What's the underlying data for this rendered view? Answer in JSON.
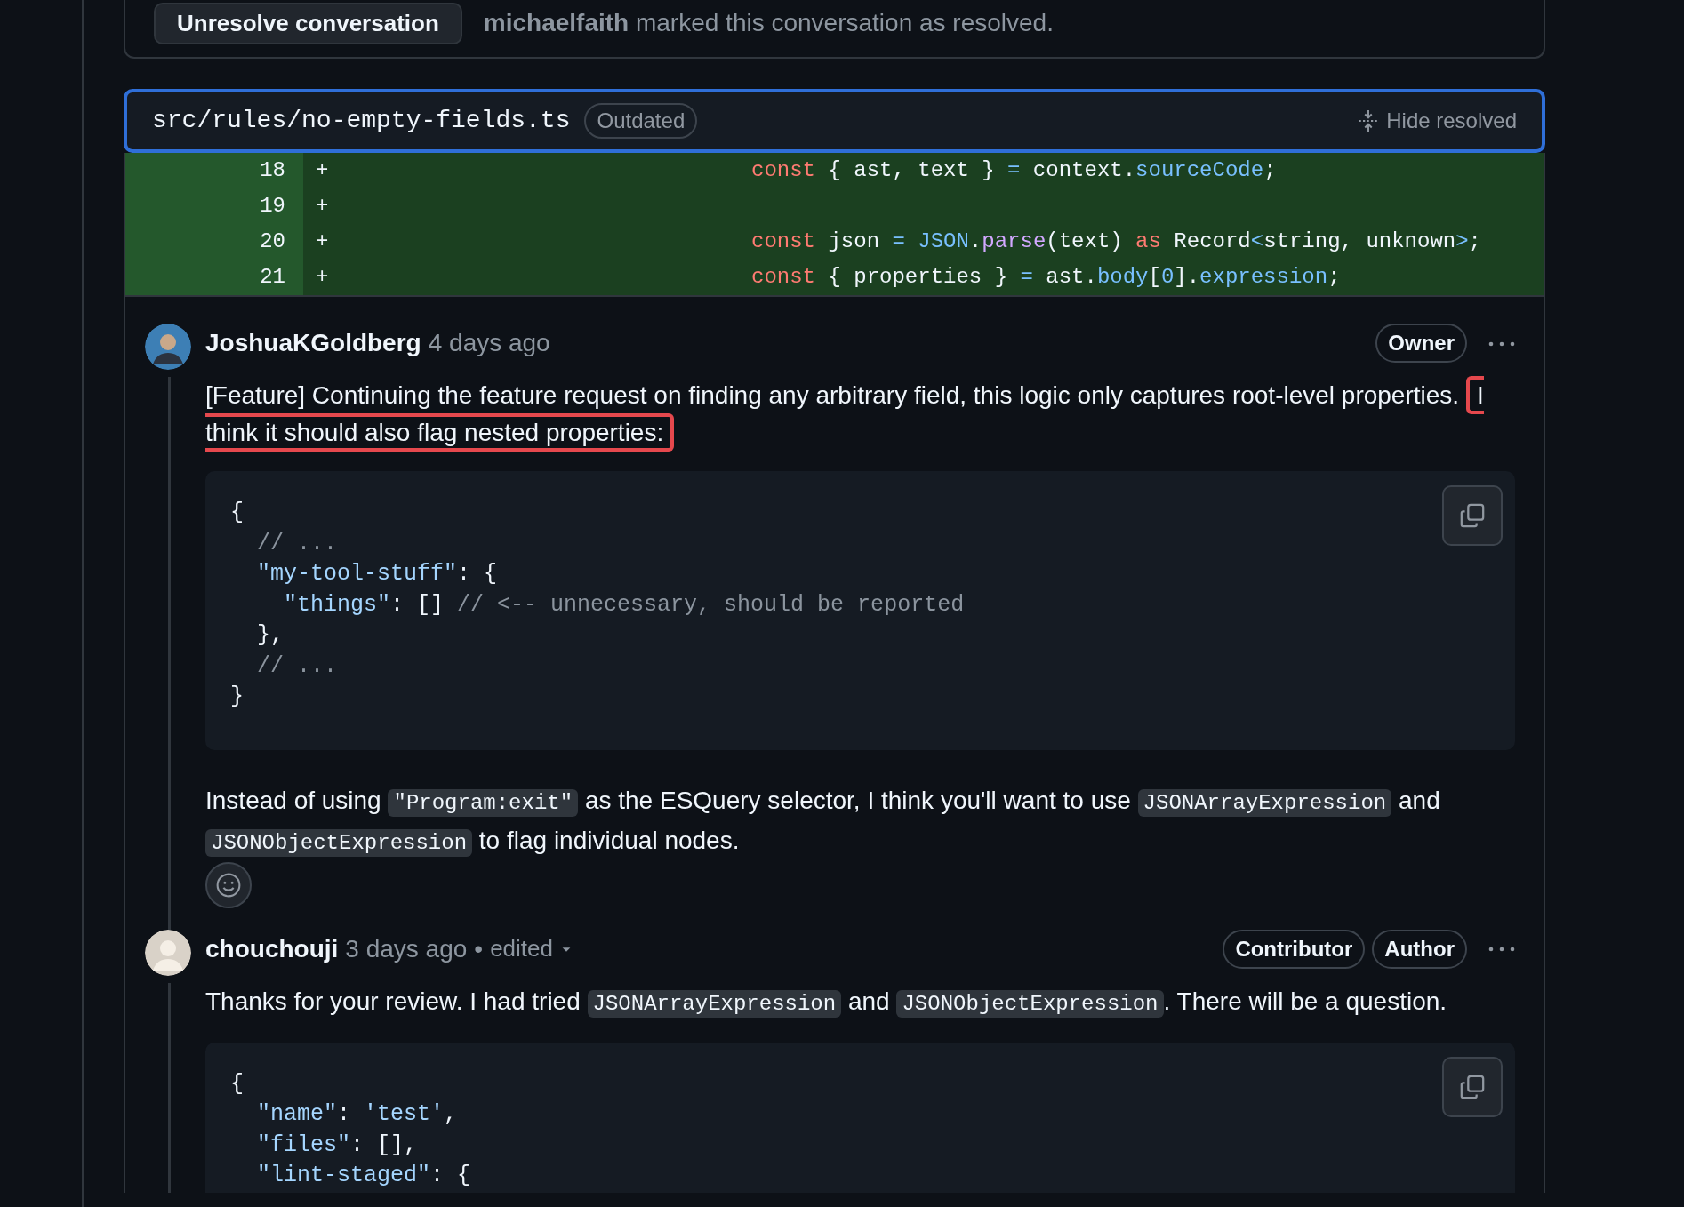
{
  "resolved_bar": {
    "button": "Unresolve conversation",
    "user": "michaelfaith",
    "message": "marked this conversation as resolved."
  },
  "file": {
    "path": "src/rules/no-empty-fields.ts",
    "badge": "Outdated",
    "action": "Hide resolved"
  },
  "diff_lines": [
    {
      "number": "18",
      "sign": "+",
      "tokens": [
        {
          "kind": "keyword",
          "text": "const"
        },
        {
          "kind": "plain",
          "text": " { ast, text } "
        },
        {
          "kind": "operator",
          "text": "="
        },
        {
          "kind": "plain",
          "text": " context."
        },
        {
          "kind": "entity",
          "text": "sourceCode"
        },
        {
          "kind": "plain",
          "text": ";"
        }
      ]
    },
    {
      "number": "19",
      "sign": "+"
    },
    {
      "number": "20",
      "sign": "+",
      "tokens": [
        {
          "kind": "keyword",
          "text": "const"
        },
        {
          "kind": "plain",
          "text": " json "
        },
        {
          "kind": "operator",
          "text": "="
        },
        {
          "kind": "entity",
          "text": " JSON"
        },
        {
          "kind": "plain",
          "text": "."
        },
        {
          "kind": "function",
          "text": "parse"
        },
        {
          "kind": "plain",
          "text": "(text) "
        },
        {
          "kind": "keyword",
          "text": "as"
        },
        {
          "kind": "plain",
          "text": " Record"
        },
        {
          "kind": "operator",
          "text": "<"
        },
        {
          "kind": "plain",
          "text": "string, unknown"
        },
        {
          "kind": "operator",
          "text": ">"
        },
        {
          "kind": "plain",
          "text": ";"
        }
      ]
    },
    {
      "number": "21",
      "sign": "+",
      "tokens": [
        {
          "kind": "keyword",
          "text": "const"
        },
        {
          "kind": "plain",
          "text": " { properties } "
        },
        {
          "kind": "operator",
          "text": "="
        },
        {
          "kind": "plain",
          "text": " ast."
        },
        {
          "kind": "entity",
          "text": "body"
        },
        {
          "kind": "plain",
          "text": "["
        },
        {
          "kind": "entity",
          "text": "0"
        },
        {
          "kind": "plain",
          "text": "]."
        },
        {
          "kind": "entity",
          "text": "expression"
        },
        {
          "kind": "plain",
          "text": ";"
        }
      ]
    }
  ],
  "comments": [
    {
      "author": "JoshuaKGoldberg",
      "time": "4 days ago",
      "badges": [
        "Owner"
      ],
      "reaction_button": true,
      "blocks": [
        {
          "kind": "paragraph",
          "parts": [
            {
              "kind": "text",
              "text": "[Feature] Continuing the feature request on finding any arbitrary field, this logic only captures root-level properties. "
            },
            {
              "kind": "highlight",
              "text": "I think it should also flag nested properties:"
            }
          ]
        },
        {
          "kind": "code",
          "lines": [
            [
              {
                "kind": "plain",
                "text": "{"
              }
            ],
            [
              {
                "kind": "comment",
                "text": "  // ..."
              }
            ],
            [
              {
                "kind": "string",
                "text": "  \"my-tool-stuff\""
              },
              {
                "kind": "plain",
                "text": ": {"
              }
            ],
            [
              {
                "kind": "string",
                "text": "    \"things\""
              },
              {
                "kind": "plain",
                "text": ": [] "
              },
              {
                "kind": "comment",
                "text": "// <-- unnecessary, should be reported"
              }
            ],
            [
              {
                "kind": "plain",
                "text": "  },"
              }
            ],
            [
              {
                "kind": "comment",
                "text": "  // ..."
              }
            ],
            [
              {
                "kind": "plain",
                "text": "}"
              }
            ]
          ]
        },
        {
          "kind": "paragraph",
          "parts": [
            {
              "kind": "text",
              "text": "Instead of using "
            },
            {
              "kind": "code",
              "text": "\"Program:exit\""
            },
            {
              "kind": "text",
              "text": " as the ESQuery selector, I think you'll want to use "
            },
            {
              "kind": "code",
              "text": "JSONArrayExpression"
            },
            {
              "kind": "text",
              "text": " and "
            },
            {
              "kind": "code",
              "text": "JSONObjectExpression"
            },
            {
              "kind": "text",
              "text": " to flag individual nodes."
            }
          ]
        }
      ]
    },
    {
      "author": "chouchouji",
      "time": "3 days ago",
      "separator": "•",
      "edited_label": "edited",
      "badges": [
        "Contributor",
        "Author"
      ],
      "blocks": [
        {
          "kind": "paragraph",
          "parts": [
            {
              "kind": "text",
              "text": "Thanks for your review. I had tried "
            },
            {
              "kind": "code",
              "text": "JSONArrayExpression"
            },
            {
              "kind": "text",
              "text": " and "
            },
            {
              "kind": "code",
              "text": "JSONObjectExpression"
            },
            {
              "kind": "text",
              "text": ". There will be a question."
            }
          ]
        },
        {
          "kind": "code",
          "lines": [
            [
              {
                "kind": "plain",
                "text": "{"
              }
            ],
            [
              {
                "kind": "string",
                "text": "  \"name\""
              },
              {
                "kind": "plain",
                "text": ": "
              },
              {
                "kind": "string",
                "text": "'test'"
              },
              {
                "kind": "plain",
                "text": ","
              }
            ],
            [
              {
                "kind": "string",
                "text": "  \"files\""
              },
              {
                "kind": "plain",
                "text": ": [],"
              }
            ],
            [
              {
                "kind": "string",
                "text": "  \"lint-staged\""
              },
              {
                "kind": "plain",
                "text": ": {"
              }
            ]
          ]
        }
      ]
    }
  ]
}
